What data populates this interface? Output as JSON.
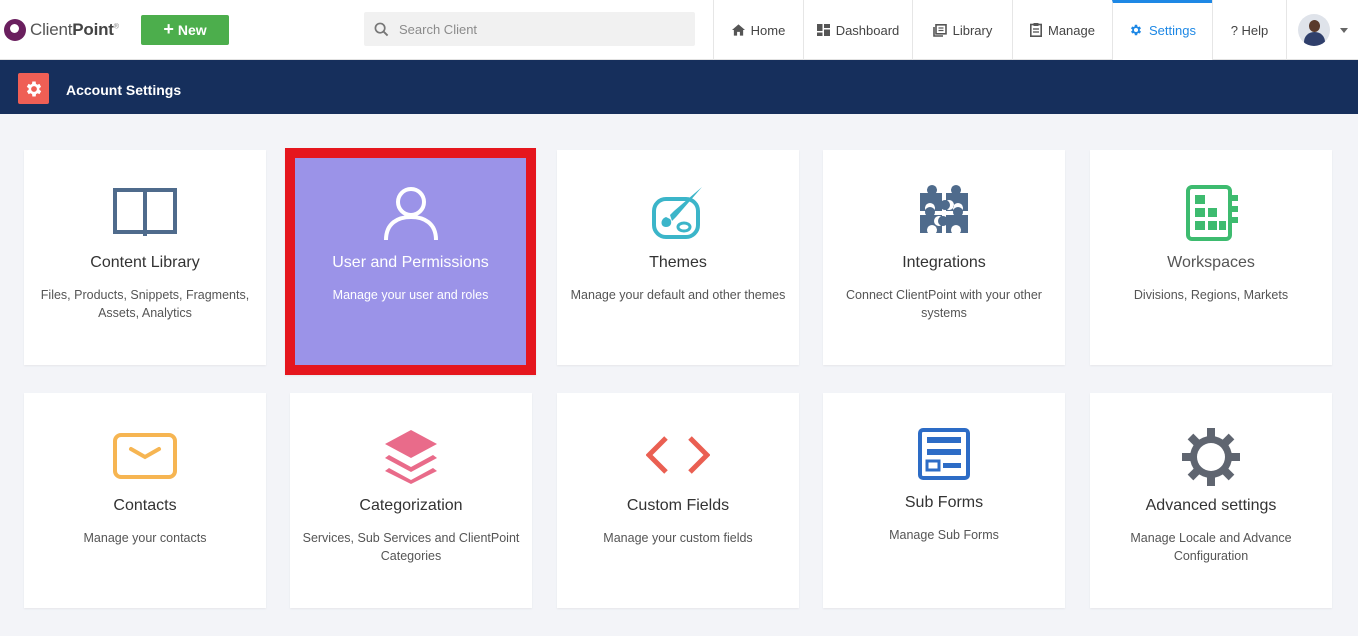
{
  "brand": {
    "name_light": "Client",
    "name_bold": "Point",
    "reg": "®"
  },
  "toolbar": {
    "new_label": "New"
  },
  "search": {
    "placeholder": "Search Client"
  },
  "nav": {
    "home": "Home",
    "dashboard": "Dashboard",
    "library": "Library",
    "manage": "Manage",
    "settings": "Settings",
    "help": "? Help"
  },
  "subheader": {
    "title": "Account Settings"
  },
  "cards": [
    {
      "title": "Content Library",
      "desc": "Files, Products, Snippets, Fragments, Assets, Analytics",
      "icon": "book-icon",
      "color": "#4f6b8c"
    },
    {
      "title": "User and Permissions",
      "desc": "Manage your user and roles",
      "icon": "user-icon",
      "color": "#ffffff"
    },
    {
      "title": "Themes",
      "desc": "Manage your default and other themes",
      "icon": "palette-icon",
      "color": "#3bb5c9"
    },
    {
      "title": "Integrations",
      "desc": "Connect ClientPoint with your other systems",
      "icon": "puzzle-icon",
      "color": "#4f6b8c"
    },
    {
      "title": "Workspaces",
      "desc": "Divisions, Regions, Markets",
      "icon": "workspace-icon",
      "color": "#3dbb6f"
    },
    {
      "title": "Contacts",
      "desc": "Manage your contacts",
      "icon": "envelope-icon",
      "color": "#f6b552"
    },
    {
      "title": "Categorization",
      "desc": "Services, Sub Services and ClientPoint Categories",
      "icon": "layers-icon",
      "color": "#e96b8a"
    },
    {
      "title": "Custom Fields",
      "desc": "Manage your custom fields",
      "icon": "code-icon",
      "color": "#ea5f52"
    },
    {
      "title": "Sub Forms",
      "desc": "Manage Sub Forms",
      "icon": "form-icon",
      "color": "#2d6cc6"
    },
    {
      "title": "Advanced settings",
      "desc": "Manage Locale and Advance Configuration",
      "icon": "cog-icon",
      "color": "#5f6570"
    }
  ]
}
